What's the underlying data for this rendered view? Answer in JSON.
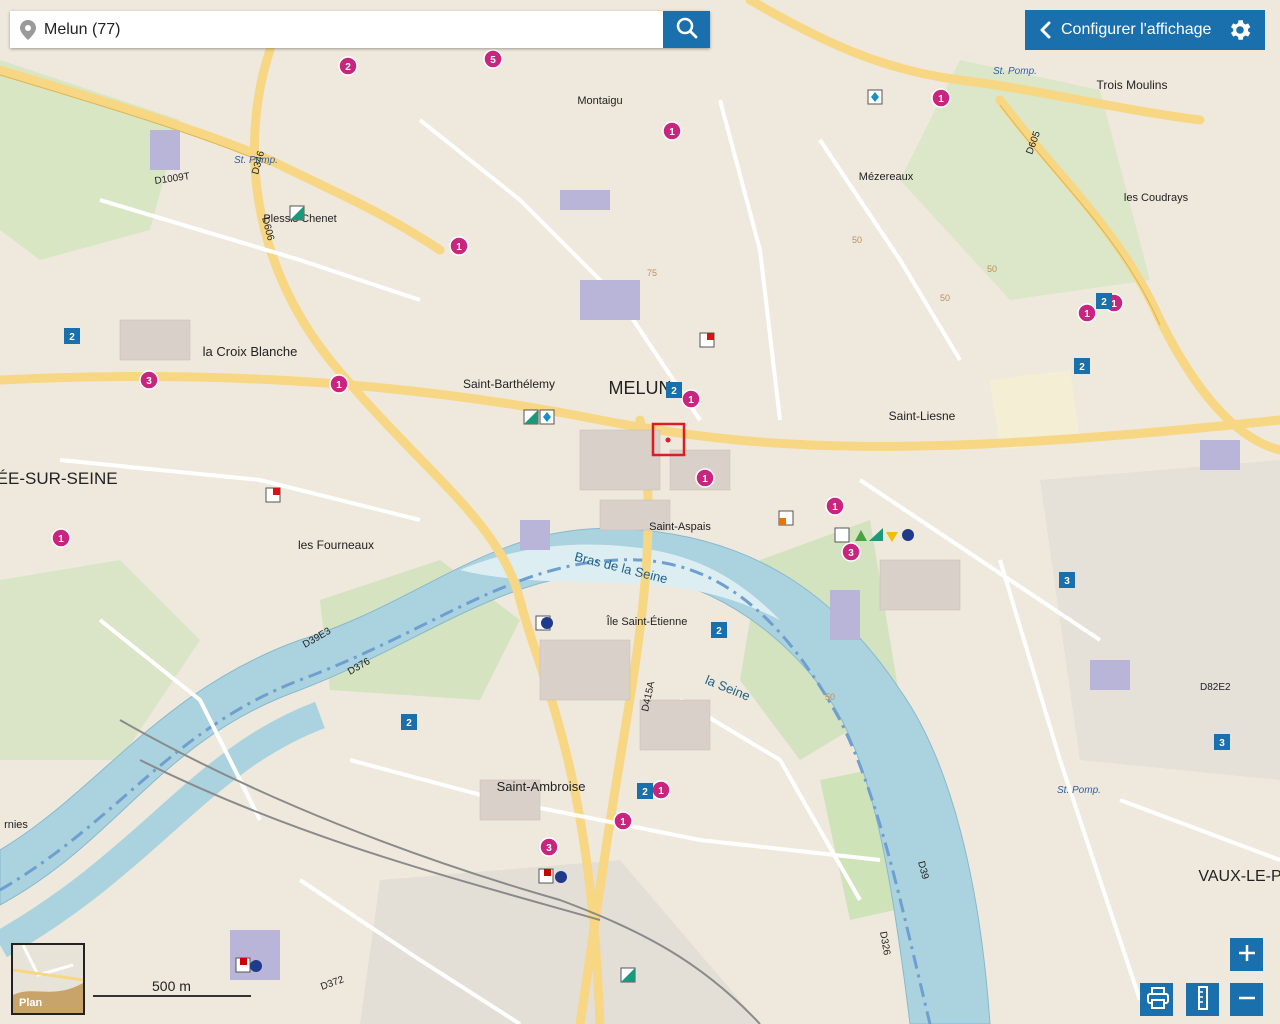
{
  "search": {
    "value": "Melun (77)"
  },
  "header": {
    "configure_label": "Configurer l'affichage"
  },
  "map": {
    "places": [
      "MELUN",
      "Saint-Barthélemy",
      "la Croix Blanche",
      "Saint-Liesne",
      "Saint-Aspais",
      "Saint-Ambroise",
      "Mézereaux",
      "les Coudrays",
      "Trois Moulins",
      "les Fourneaux",
      "Île Saint-Étienne",
      "VAUX-LE-P",
      "É MÉE-SUR-SEINE",
      "Plessis Chenet",
      "Montaigu"
    ],
    "water_labels": [
      "Bras de la Seine",
      "la Seine"
    ],
    "roads": [
      "D605",
      "D606",
      "D346",
      "D1009T",
      "D39E3",
      "D376",
      "D415A",
      "D372",
      "D39",
      "D82E2",
      "D326"
    ],
    "stops": [
      "St. Pomp.",
      "St. Pomp.",
      "St. Pomp."
    ],
    "contours": [
      "50",
      "50",
      "75",
      "50",
      "50"
    ],
    "pois_counts": [
      {
        "label": "1",
        "color": "#c8267e"
      },
      {
        "label": "2",
        "color": "#c8267e"
      },
      {
        "label": "3",
        "color": "#c8267e"
      },
      {
        "label": "5",
        "color": "#c8267e"
      },
      {
        "label": "2",
        "color": "#1a6fad"
      },
      {
        "label": "3",
        "color": "#1a6fad"
      }
    ],
    "edge_labels": [
      "rnies"
    ]
  },
  "scale": {
    "label": "500 m"
  },
  "minimap": {
    "label": "Plan"
  },
  "colors": {
    "accent": "#1a6fad",
    "poi_pink": "#c8267e",
    "water": "#aad3df",
    "river_stroke": "#4d88b8"
  }
}
